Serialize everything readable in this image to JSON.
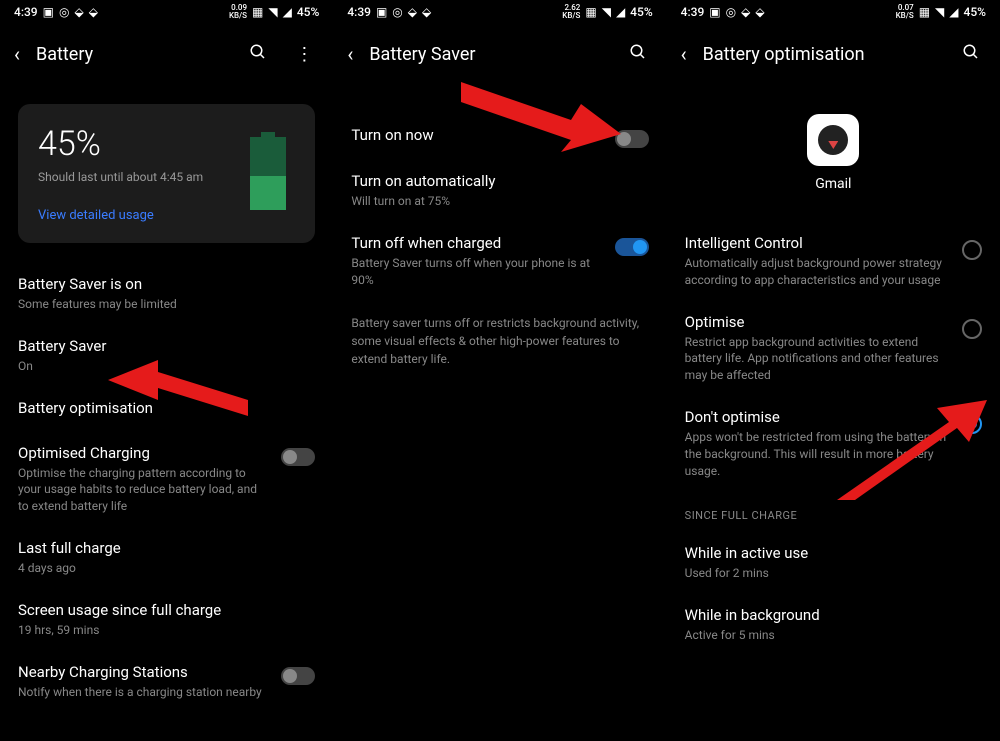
{
  "status": {
    "time": "4:39",
    "battery": "45%",
    "kbs1": "0.09",
    "kbs2": "2.62",
    "kbs3": "0.07",
    "kbs_label": "KB/S"
  },
  "screen1": {
    "title": "Battery",
    "percent": "45%",
    "lastUntil": "Should last until about 4:45 am",
    "viewUsage": "View detailed usage",
    "saverStatus": {
      "title": "Battery Saver is on",
      "sub": "Some features may be limited"
    },
    "saver": {
      "title": "Battery Saver",
      "sub": "On"
    },
    "optimisation": "Battery optimisation",
    "optCharging": {
      "title": "Optimised Charging",
      "sub": "Optimise the charging pattern according to your usage habits to reduce battery load, and to extend battery life"
    },
    "lastCharge": {
      "title": "Last full charge",
      "sub": "4 days ago"
    },
    "screenUsage": {
      "title": "Screen usage since full charge",
      "sub": "19 hrs, 59 mins"
    },
    "nearby": {
      "title": "Nearby Charging Stations",
      "sub": "Notify when there is a charging station nearby"
    }
  },
  "screen2": {
    "title": "Battery Saver",
    "turnOn": "Turn on now",
    "auto": {
      "title": "Turn on automatically",
      "sub": "Will turn on at 75%"
    },
    "turnOff": {
      "title": "Turn off when charged",
      "sub": "Battery Saver turns off when your phone is at 90%"
    },
    "desc": "Battery saver turns off or restricts background activity, some visual effects & other high-power features to extend battery life."
  },
  "screen3": {
    "title": "Battery optimisation",
    "appName": "Gmail",
    "intelligent": {
      "title": "Intelligent Control",
      "sub": "Automatically adjust background power strategy according to app characteristics and your usage"
    },
    "optimise": {
      "title": "Optimise",
      "sub": "Restrict app background activities to extend battery life. App notifications and other features may be affected"
    },
    "dontOptimise": {
      "title": "Don't optimise",
      "sub": "Apps won't be restricted from using the battery in the background. This will result in more battery usage."
    },
    "sinceHeader": "SINCE FULL CHARGE",
    "active": {
      "title": "While in active use",
      "sub": "Used for 2 mins"
    },
    "background": {
      "title": "While in background",
      "sub": "Active for 5 mins"
    }
  }
}
